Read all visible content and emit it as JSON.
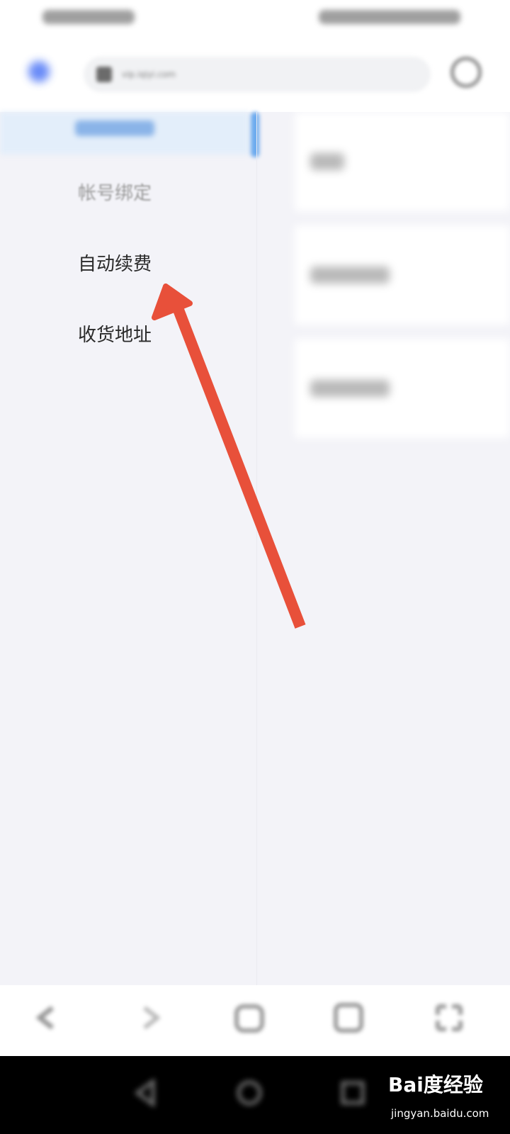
{
  "browser": {
    "url": "vip.iqiyi.com"
  },
  "menu": {
    "items": [
      {
        "label": "帐号绑定",
        "state": "blurred"
      },
      {
        "label": "自动续费",
        "state": "normal"
      },
      {
        "label": "收货地址",
        "state": "normal"
      }
    ]
  },
  "colors": {
    "accent": "#4f77f6",
    "selected_bg": "#e3eefa",
    "annotation_arrow": "#e8503a"
  },
  "watermark": {
    "logo": "Bai度经验",
    "sub": "jingyan.baidu.com"
  }
}
